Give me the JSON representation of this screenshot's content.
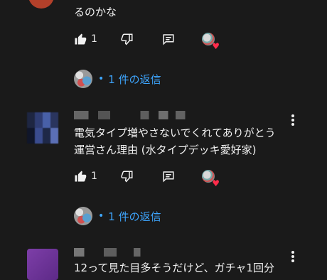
{
  "comments": [
    {
      "text_lines": [
        "るのかな"
      ],
      "likes": "1",
      "reply_label": "1 件の返信",
      "reply_dot": "•"
    },
    {
      "text_lines": [
        "電気タイプ増やさないでくれてありがとう",
        "運営さん理由 (水タイプデッキ愛好家)"
      ],
      "likes": "1",
      "reply_label": "1 件の返信",
      "reply_dot": "•"
    },
    {
      "text_lines": [
        "12って見た目多そうだけど、ガチャ1回分"
      ]
    }
  ],
  "icons": {
    "like": "thumbs-up-icon",
    "dislike": "thumbs-down-icon",
    "reply": "comment-icon",
    "heart": "heart-icon",
    "more": "more-vert-icon"
  },
  "colors": {
    "background": "#1a1a1a",
    "link": "#3ea6ff",
    "heart": "#ff2b4a"
  }
}
